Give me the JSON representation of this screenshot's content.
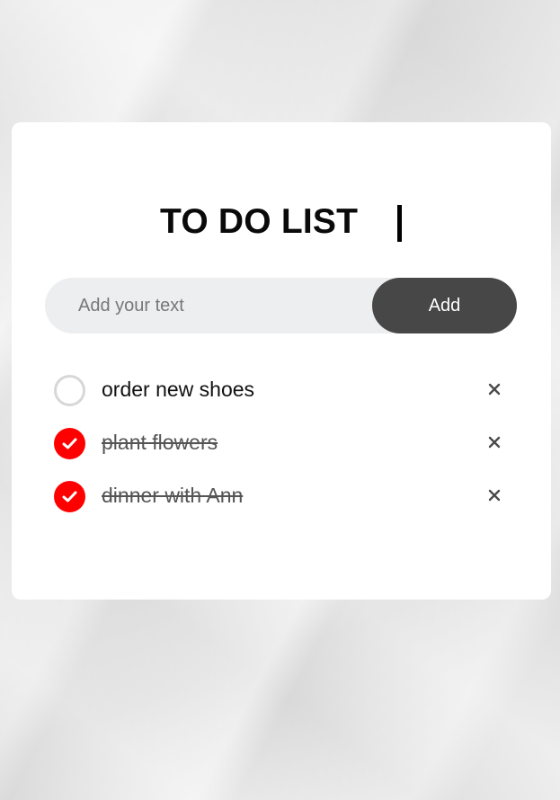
{
  "app": {
    "title": "TO DO LIST"
  },
  "input": {
    "placeholder": "Add your text",
    "value": "",
    "add_label": "Add"
  },
  "todos": [
    {
      "text": "order new shoes",
      "done": false
    },
    {
      "text": "plant flowers",
      "done": true
    },
    {
      "text": "dinner with Ann",
      "done": true
    }
  ],
  "icons": {
    "checkbox_unchecked": "empty-circle-icon",
    "checkbox_checked": "checkmark-circle-icon",
    "delete": "close-icon"
  },
  "colors": {
    "accent_checked": "#ff0000",
    "button_bg": "#474747",
    "input_bg": "#edeef0",
    "card_bg": "#ffffff"
  }
}
